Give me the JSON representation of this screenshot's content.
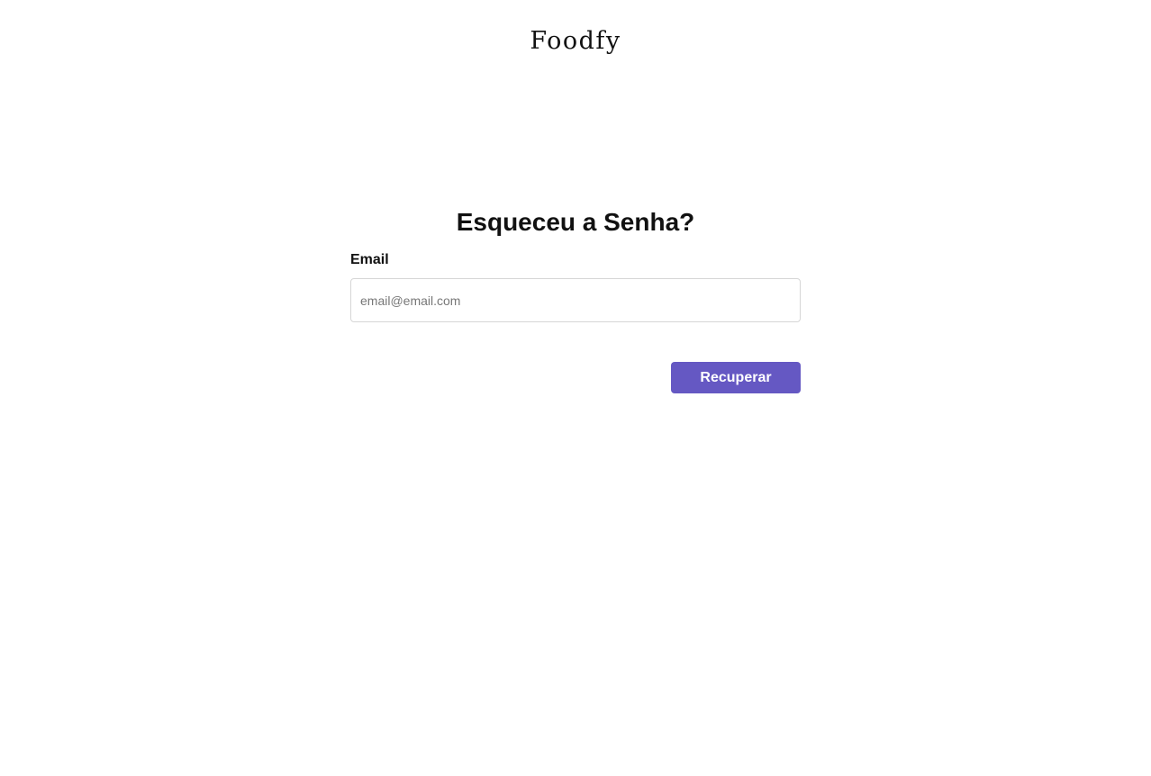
{
  "brand": {
    "logo_text": "Foodfy"
  },
  "main": {
    "title": "Esqueceu a Senha?",
    "email_label": "Email",
    "email_value": "",
    "email_placeholder": "email@email.com",
    "submit_label": "Recuperar"
  },
  "colors": {
    "accent": "#6558c3",
    "text": "#111111",
    "input_border": "#d6d6d6",
    "background": "#ffffff"
  }
}
